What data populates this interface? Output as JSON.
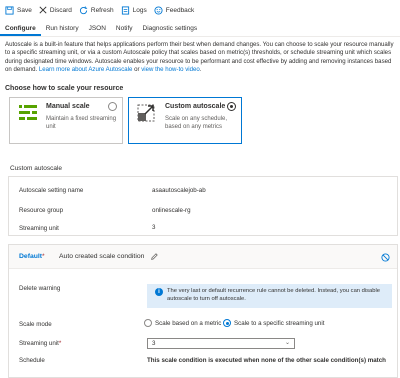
{
  "toolbar": {
    "save": "Save",
    "discard": "Discard",
    "refresh": "Refresh",
    "logs": "Logs",
    "feedback": "Feedback"
  },
  "tabs": [
    {
      "label": "Configure",
      "active": true
    },
    {
      "label": "Run history",
      "active": false
    },
    {
      "label": "JSON",
      "active": false
    },
    {
      "label": "Notify",
      "active": false
    },
    {
      "label": "Diagnostic settings",
      "active": false
    }
  ],
  "intro": {
    "text": "Autoscale is a built-in feature that helps applications perform their best when demand changes. You can choose to scale your resource manually to a specific streaming unit, or via a custom Autoscale policy that scales based on metric(s) thresholds, or schedule streaming unit which scales during designated time windows. Autoscale enables your resource to be performant and cost effective by adding and removing instances based on demand.",
    "link1": "Learn more about Azure Autoscale",
    "connector": " or ",
    "link2": "view the how-to video",
    "end": "."
  },
  "choose_heading": "Choose how to scale your resource",
  "cards": {
    "manual": {
      "title": "Manual scale",
      "desc": "Maintain a fixed streaming unit",
      "selected": false
    },
    "custom": {
      "title": "Custom autoscale",
      "desc": "Scale on any schedule, based on any metrics",
      "selected": true
    }
  },
  "custom_section": {
    "heading": "Custom autoscale",
    "setting_name_label": "Autoscale setting name",
    "setting_name_value": "asaautoscalejob-ab",
    "resource_group_label": "Resource group",
    "resource_group_value": "onlinescale-rg",
    "streaming_unit_label": "Streaming unit",
    "streaming_unit_value": "3"
  },
  "condition": {
    "default_label": "Default",
    "required_mark": "*",
    "name": "Auto created scale condition",
    "delete_warning_label": "Delete warning",
    "info_text": "The very last or default recurrence rule cannot be deleted. Instead, you can disable autoscale to turn off autoscale.",
    "scale_mode_label": "Scale mode",
    "mode_metric": "Scale based on a metric",
    "mode_specific": "Scale to a specific streaming unit",
    "mode_selected": "specific",
    "streaming_unit_label": "Streaming unit",
    "streaming_unit_value": "3",
    "schedule_label": "Schedule",
    "schedule_value": "This scale condition is executed when none of the other scale condition(s) match"
  },
  "colors": {
    "accent": "#0078d4",
    "info_bg": "#deecf9",
    "required": "#a4262c"
  },
  "icons": [
    "save-icon",
    "discard-icon",
    "refresh-icon",
    "logs-icon",
    "feedback-icon",
    "manual-scale-icon",
    "custom-autoscale-icon",
    "pencil-icon",
    "disable-icon",
    "info-icon",
    "chevron-down-icon"
  ]
}
